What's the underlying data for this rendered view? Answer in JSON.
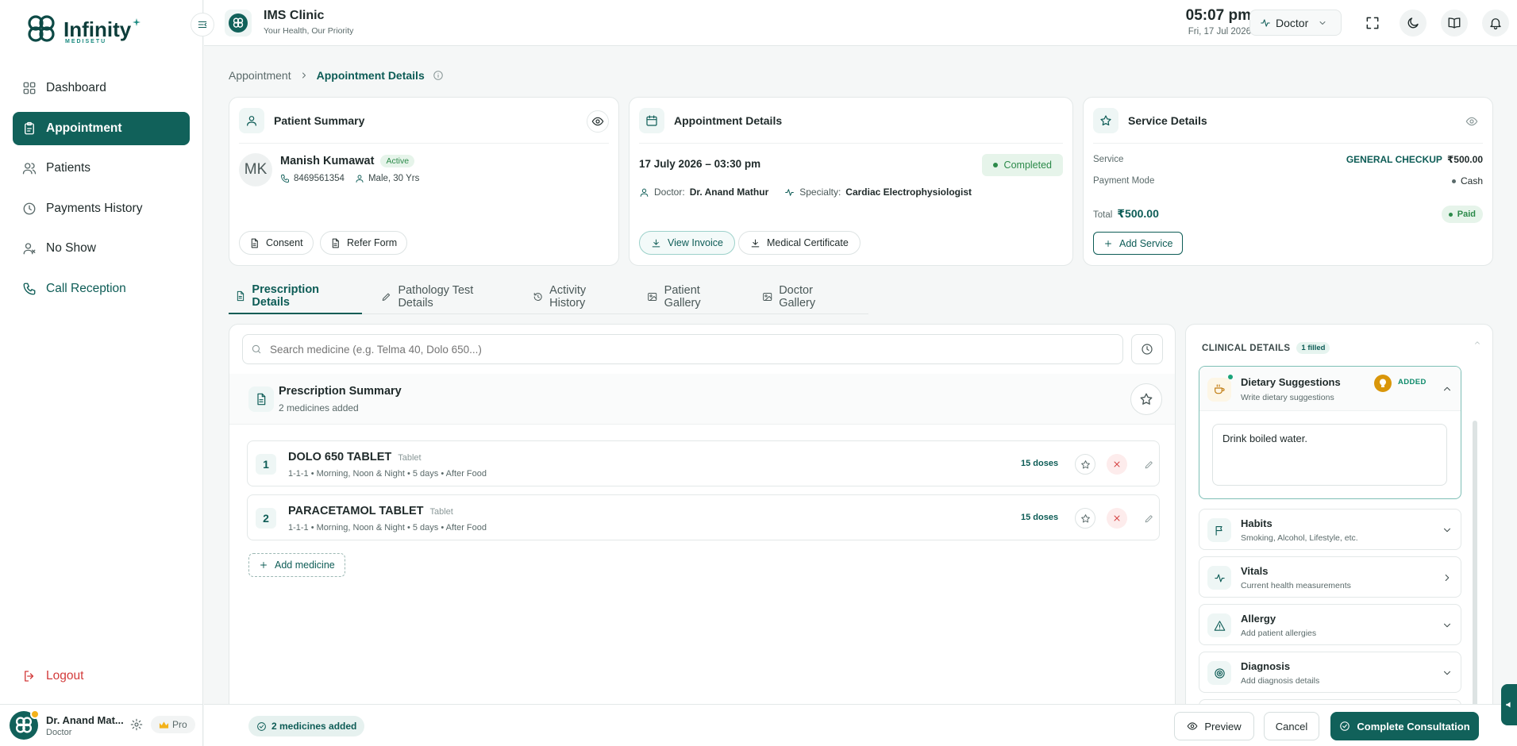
{
  "app": {
    "logo_text": "Infinity",
    "logo_sub": "MEDISETU"
  },
  "sidebar": {
    "items": [
      {
        "label": "Dashboard",
        "icon": "grid-icon",
        "active": false
      },
      {
        "label": "Appointment",
        "icon": "clipboard-icon",
        "active": true
      },
      {
        "label": "Patients",
        "icon": "users-icon",
        "active": false
      },
      {
        "label": "Payments History",
        "icon": "clock-icon",
        "active": false
      },
      {
        "label": "No Show",
        "icon": "user-x-icon",
        "active": false
      },
      {
        "label": "Call Reception",
        "icon": "phone-icon",
        "active": false
      }
    ],
    "logout_label": "Logout",
    "user": {
      "name": "Dr. Anand Mat...",
      "role": "Doctor",
      "plan": "Pro"
    }
  },
  "header": {
    "clinic_name": "IMS Clinic",
    "clinic_tagline": "Your Health, Our Priority",
    "time": "05:07 pm",
    "date": "Fri, 17 Jul 2026",
    "role_selected": "Doctor"
  },
  "breadcrumb": {
    "parent": "Appointment",
    "current": "Appointment Details"
  },
  "patient_summary": {
    "title": "Patient Summary",
    "initials": "MK",
    "name": "Manish Kumawat",
    "status": "Active",
    "phone": "8469561354",
    "gender_age": "Male, 30 Yrs",
    "consent_label": "Consent",
    "refer_label": "Refer Form"
  },
  "appointment_details": {
    "title": "Appointment Details",
    "datetime": "17 July 2026 – 03:30 pm",
    "status": "Completed",
    "doctor_label": "Doctor:",
    "doctor": "Dr. Anand Mathur",
    "specialty_label": "Specialty:",
    "specialty": "Cardiac Electrophysiologist",
    "invoice_label": "View Invoice",
    "certificate_label": "Medical Certificate"
  },
  "service_details": {
    "title": "Service Details",
    "service_label": "Service",
    "service_name": "GENERAL CHECKUP",
    "service_price": "₹500.00",
    "payment_label": "Payment Mode",
    "payment_mode": "Cash",
    "total_label": "Total",
    "total": "₹500.00",
    "payment_status": "Paid",
    "add_service_label": "Add Service"
  },
  "tabs": [
    {
      "label": "Prescription Details",
      "active": true
    },
    {
      "label": "Pathology Test Details",
      "active": false
    },
    {
      "label": "Activity History",
      "active": false
    },
    {
      "label": "Patient Gallery",
      "active": false
    },
    {
      "label": "Doctor Gallery",
      "active": false
    }
  ],
  "prescription": {
    "search_placeholder": "Search medicine (e.g. Telma 40, Dolo 650...)",
    "summary_title": "Prescription Summary",
    "summary_sub": "2 medicines added",
    "medicines": [
      {
        "num": "1",
        "name": "DOLO 650 TABLET",
        "type": "Tablet",
        "detail": "1-1-1 • Morning, Noon & Night • 5 days • After Food",
        "doses": "15 doses"
      },
      {
        "num": "2",
        "name": "PARACETAMOL TABLET",
        "type": "Tablet",
        "detail": "1-1-1 • Morning, Noon & Night • 5 days • After Food",
        "doses": "15 doses"
      }
    ],
    "add_label": "Add medicine"
  },
  "clinical": {
    "header": "CLINICAL DETAILS",
    "filled_badge": "1 filled",
    "dietary": {
      "title": "Dietary Suggestions",
      "sub": "Write dietary suggestions",
      "badge": "ADDED",
      "text": "Drink boiled water."
    },
    "items": [
      {
        "title": "Habits",
        "sub": "Smoking, Alcohol, Lifestyle, etc.",
        "icon": "flag-icon",
        "chevron": "down"
      },
      {
        "title": "Vitals",
        "sub": "Current health measurements",
        "icon": "activity-icon",
        "chevron": "right"
      },
      {
        "title": "Allergy",
        "sub": "Add patient allergies",
        "icon": "alert-icon",
        "chevron": "down"
      },
      {
        "title": "Diagnosis",
        "sub": "Add diagnosis details",
        "icon": "target-icon",
        "chevron": "down"
      }
    ]
  },
  "footer": {
    "badge": "2 medicines added",
    "preview_label": "Preview",
    "cancel_label": "Cancel",
    "complete_label": "Complete Consultation"
  },
  "colors": {
    "primary": "#11615a",
    "accent_text": "#0d5c56",
    "danger": "#d33b3b",
    "warning": "#d9960a"
  }
}
